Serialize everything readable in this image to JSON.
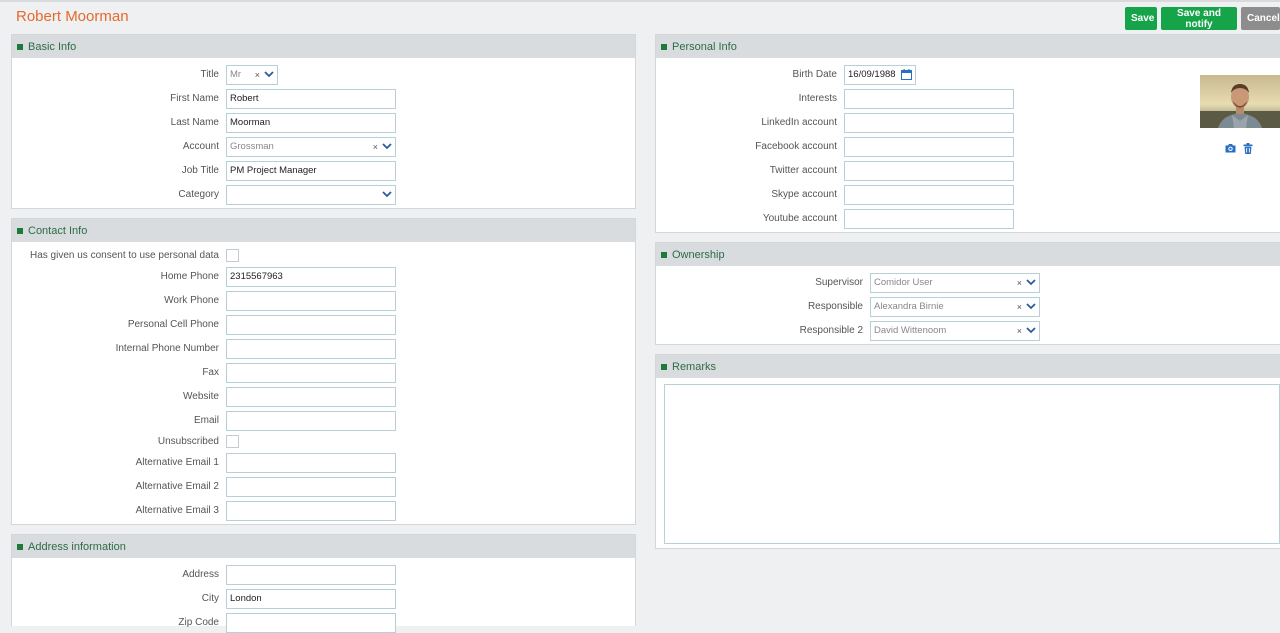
{
  "page": {
    "title": "Robert Moorman"
  },
  "actions": {
    "save": "Save",
    "save_notify": "Save and notify",
    "cancel": "Cancel"
  },
  "basic_info": {
    "title": "Basic Info",
    "fields": {
      "title_label": "Title",
      "title_value": "Mr",
      "first_name_label": "First Name",
      "first_name_value": "Robert",
      "last_name_label": "Last Name",
      "last_name_value": "Moorman",
      "account_label": "Account",
      "account_value": "Grossman",
      "job_title_label": "Job Title",
      "job_title_value": "PM Project Manager",
      "category_label": "Category",
      "category_value": ""
    }
  },
  "contact_info": {
    "title": "Contact Info",
    "consent_label": "Has given us consent to use personal data",
    "home_phone_label": "Home Phone",
    "home_phone_value": "2315567963",
    "work_phone_label": "Work Phone",
    "cell_phone_label": "Personal Cell Phone",
    "internal_phone_label": "Internal Phone Number",
    "fax_label": "Fax",
    "website_label": "Website",
    "email_label": "Email",
    "unsubscribed_label": "Unsubscribed",
    "alt_email1_label": "Alternative Email 1",
    "alt_email2_label": "Alternative Email 2",
    "alt_email3_label": "Alternative Email 3"
  },
  "address_info": {
    "title": "Address information",
    "address_label": "Address",
    "city_label": "City",
    "city_value": "London",
    "zip_label": "Zip Code"
  },
  "personal_info": {
    "title": "Personal Info",
    "birth_date_label": "Birth Date",
    "birth_date_value": "16/09/1988",
    "interests_label": "Interests",
    "linkedin_label": "LinkedIn account",
    "facebook_label": "Facebook account",
    "twitter_label": "Twitter account",
    "skype_label": "Skype account",
    "youtube_label": "Youtube account"
  },
  "ownership": {
    "title": "Ownership",
    "supervisor_label": "Supervisor",
    "supervisor_value": "Comidor User",
    "responsible_label": "Responsible",
    "responsible_value": "Alexandra Birnie",
    "responsible2_label": "Responsible 2",
    "responsible2_value": "David Wittenoom"
  },
  "remarks": {
    "title": "Remarks"
  },
  "colors": {
    "accent_orange": "#e46a2e",
    "button_green": "#15a44a",
    "button_gray": "#8d8d8d",
    "header_green": "#2e6b45"
  }
}
